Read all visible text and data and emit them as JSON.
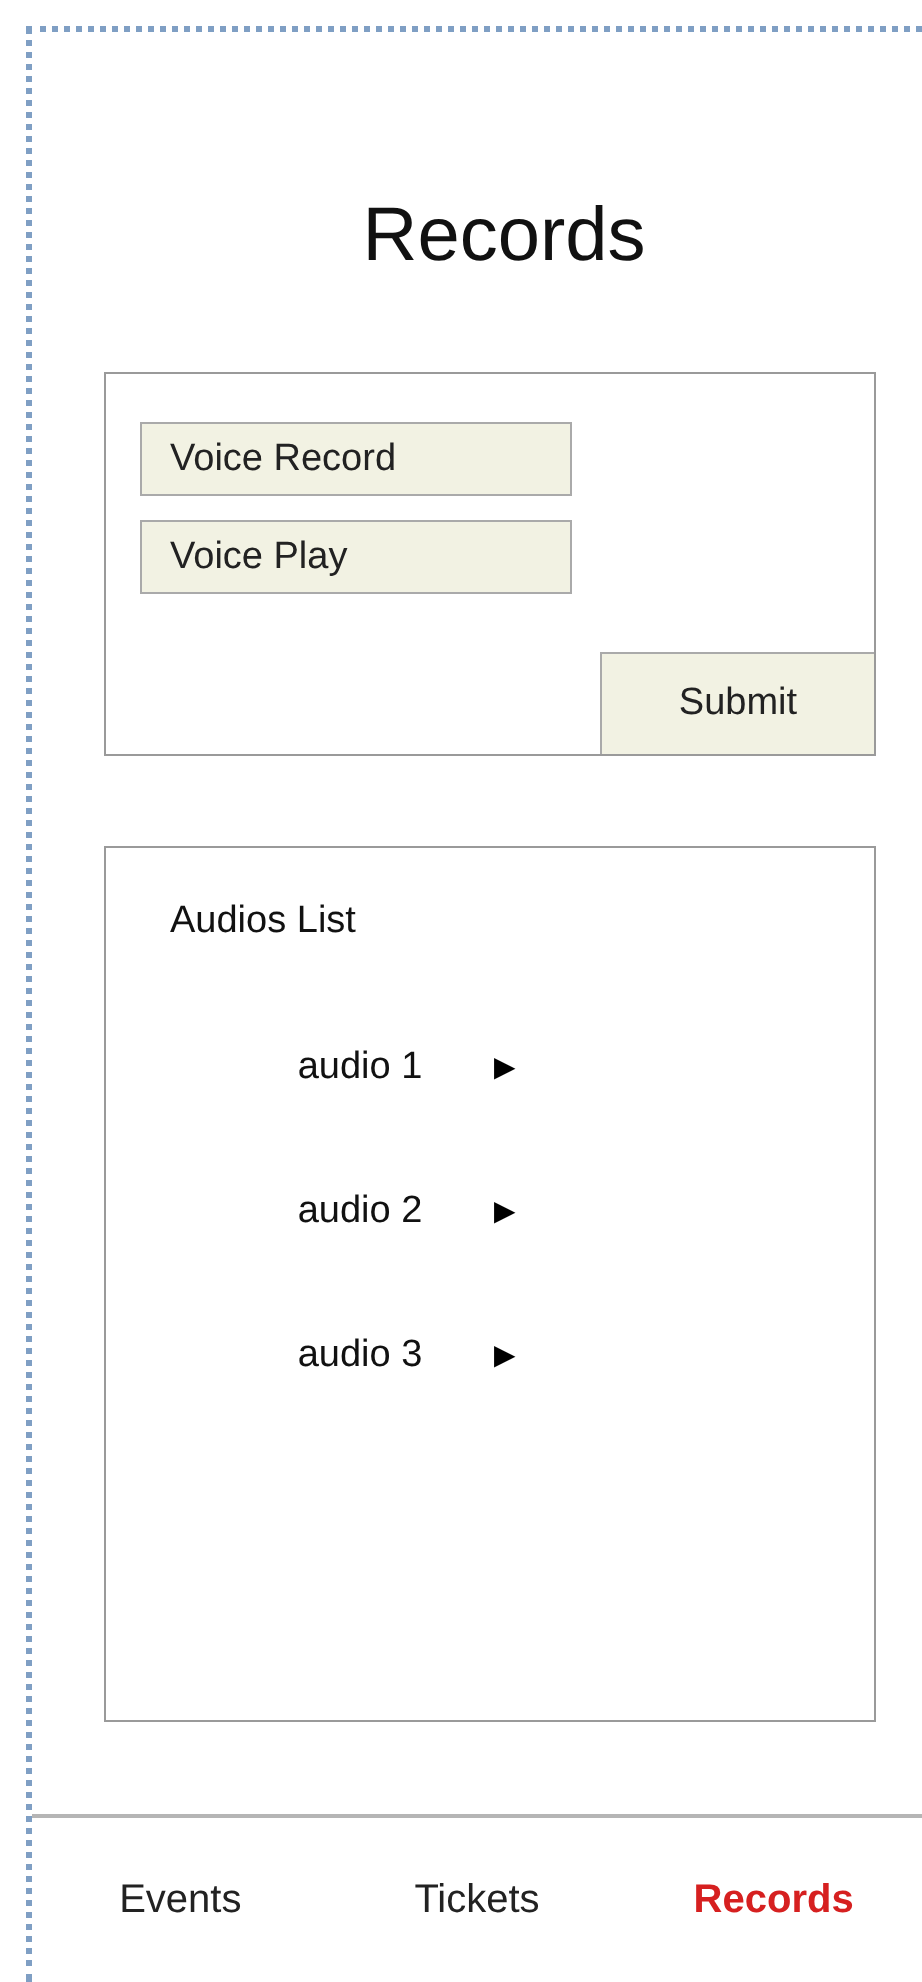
{
  "title": "Records",
  "form": {
    "buttons": [
      {
        "label": "Voice Record"
      },
      {
        "label": "Voice Play"
      }
    ],
    "submit": "Submit"
  },
  "audios": {
    "heading": "Audios List",
    "items": [
      {
        "name": "audio 1",
        "play": "▶"
      },
      {
        "name": "audio 2",
        "play": "▶"
      },
      {
        "name": "audio 3",
        "play": "▶"
      }
    ]
  },
  "tabs": [
    {
      "label": "Events",
      "selected": false
    },
    {
      "label": "Tickets",
      "selected": false
    },
    {
      "label": "Records",
      "selected": true
    }
  ]
}
